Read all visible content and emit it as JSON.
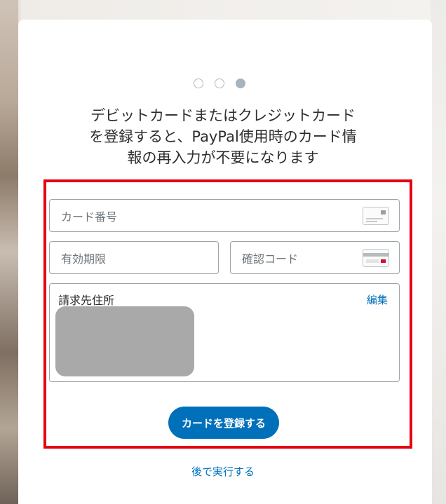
{
  "progress": {
    "total_steps": 3,
    "current_step": 3
  },
  "headline": {
    "line1": "デビットカードまたはクレジットカード",
    "line2": "を登録すると、PayPal使用時のカード情",
    "line3": "報の再入力が不要になります"
  },
  "form": {
    "card_number": {
      "placeholder": "カード番号",
      "value": ""
    },
    "expiry": {
      "placeholder": "有効期限",
      "value": ""
    },
    "cvv": {
      "placeholder": "確認コード",
      "value": ""
    },
    "billing_address": {
      "label": "請求先住所",
      "edit_label": "編集"
    },
    "submit_label": "カードを登録する"
  },
  "later_link": "後で実行する",
  "colors": {
    "accent": "#0070ba",
    "highlight_border": "#e60012",
    "redaction": "#a9a9a9"
  },
  "icons": {
    "card_number_icon": "credit-card-front-icon",
    "cvv_icon": "credit-card-back-icon"
  }
}
